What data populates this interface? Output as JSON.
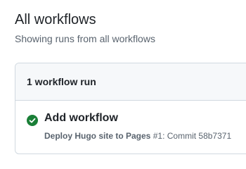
{
  "header": {
    "title": "All workflows",
    "subtitle": "Showing runs from all workflows"
  },
  "runs": {
    "count_label": "1 workflow run",
    "items": [
      {
        "title": "Add workflow",
        "workflow_name": "Deploy Hugo site to Pages",
        "run_number": "#1",
        "commit_text": ": Commit 58b7371",
        "status": "success",
        "status_icon": "check-circle-fill-icon",
        "status_color": "#1a7f37"
      }
    ]
  }
}
